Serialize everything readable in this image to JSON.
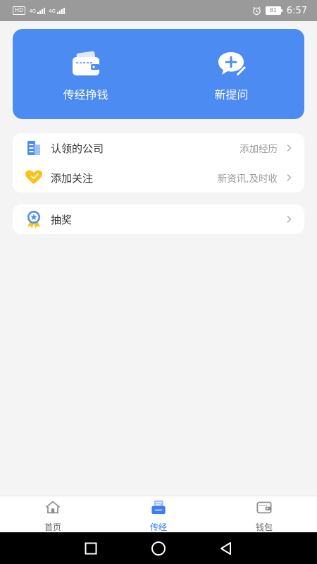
{
  "status_bar": {
    "hd_label": "HD",
    "signal_1_label": "4G",
    "signal_2_label": "4G",
    "battery_level": "81",
    "time": "6:57",
    "icons": [
      "alarm-icon",
      "battery-icon",
      "signal-icon"
    ]
  },
  "hero": {
    "items": [
      {
        "label": "传经挣钱",
        "icon": "wallet-icon"
      },
      {
        "label": "新提问",
        "icon": "add-question-icon"
      }
    ],
    "background": "#4b8bf2"
  },
  "list": {
    "rows": [
      {
        "label": "认领的公司",
        "hint": "添加经历",
        "icon": "building-icon"
      },
      {
        "label": "添加关注",
        "hint": "新资讯,及时收",
        "icon": "heart-icon"
      }
    ]
  },
  "lottery": {
    "label": "抽奖",
    "icon": "medal-icon"
  },
  "bottom_nav": {
    "items": [
      {
        "label": "首页",
        "icon": "home-icon",
        "active": false
      },
      {
        "label": "传经",
        "icon": "share-experience-icon",
        "active": true
      },
      {
        "label": "钱包",
        "icon": "wallet-icon",
        "active": false
      }
    ],
    "active_color": "#3a7ef0"
  },
  "system_nav": {
    "icons": [
      "recent-apps-icon",
      "home-circle-icon",
      "back-icon"
    ]
  }
}
